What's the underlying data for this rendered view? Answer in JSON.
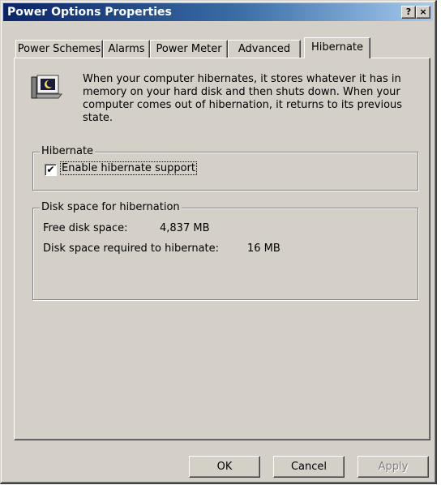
{
  "window": {
    "title": "Power Options Properties",
    "help_label": "?",
    "close_label": "×"
  },
  "tabs": [
    {
      "label": "Power Schemes",
      "active": false
    },
    {
      "label": "Alarms",
      "active": false
    },
    {
      "label": "Power Meter",
      "active": false
    },
    {
      "label": "Advanced",
      "active": false
    },
    {
      "label": "Hibernate",
      "active": true
    }
  ],
  "info": {
    "icon": "hibernate-computer-icon",
    "text": "When your computer hibernates, it stores whatever it has in memory on your hard disk and then shuts down. When your computer comes out of hibernation, it returns to its previous state."
  },
  "hibernate_group": {
    "legend": "Hibernate",
    "checkbox_label": "Enable hibernate support",
    "checked": true,
    "check_glyph": "✔"
  },
  "disk_group": {
    "legend": "Disk space for hibernation",
    "free_label": "Free disk space:",
    "free_value": "4,837 MB",
    "required_label": "Disk space required to hibernate:",
    "required_value": "16 MB"
  },
  "buttons": {
    "ok": "OK",
    "cancel": "Cancel",
    "apply": "Apply"
  },
  "colors": {
    "face": "#d4d0c8",
    "title_start": "#0a246a",
    "title_end": "#a6caf0"
  }
}
